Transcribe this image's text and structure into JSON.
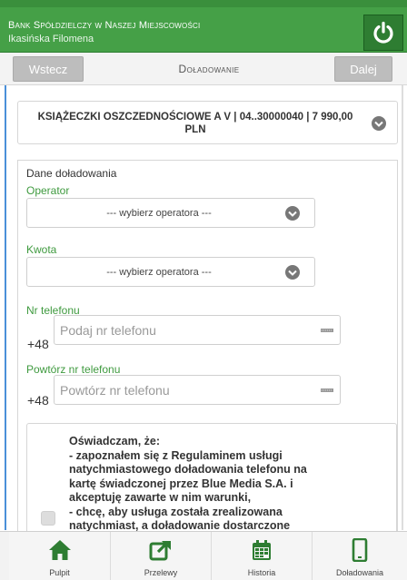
{
  "header": {
    "bank_name": "Bank Spółdzielczy w Naszej Miejscowości",
    "user_name": "Ikasińska Filomena",
    "power_icon": "power-icon"
  },
  "nav": {
    "back_label": "Wstecz",
    "title": "Doładowanie",
    "next_label": "Dalej"
  },
  "account": {
    "label": "KSIĄŻECZKI OSZCZEDNOŚCIOWE A V | 04..30000040 | 7 990,00 PLN"
  },
  "form": {
    "section_title": "Dane doładowania",
    "operator_label": "Operator",
    "operator_value": "--- wybierz operatora ---",
    "amount_label": "Kwota",
    "amount_value": "--- wybierz operatora ---",
    "phone_label": "Nr telefonu",
    "phone_prefix": "+48",
    "phone_placeholder": "Podaj nr telefonu",
    "phone_repeat_label": "Powtórz nr telefonu",
    "phone_repeat_prefix": "+48",
    "phone_repeat_placeholder": "Powtórz nr telefonu"
  },
  "consent": {
    "lines": [
      "Oświadczam, że:",
      "- zapoznałem się z Regulaminem usługi",
      "natychmiastowego doładowania telefonu na",
      "kartę świadczonej przez Blue Media S.A. i",
      "akceptuję zawarte w nim warunki,",
      "- chcę, aby usługa została zrealizowana",
      "natychmiast, a doładowanie dostarczone"
    ]
  },
  "tabs": [
    {
      "label": "Pulpit",
      "icon": "home-icon"
    },
    {
      "label": "Przelewy",
      "icon": "share-arrow-icon"
    },
    {
      "label": "Historia",
      "icon": "calendar-icon"
    },
    {
      "label": "Doładowania",
      "icon": "phone-icon"
    }
  ],
  "colors": {
    "brand_green": "#45a047",
    "label_green": "#3f9a3f",
    "accent_blue": "#4a90d9"
  }
}
